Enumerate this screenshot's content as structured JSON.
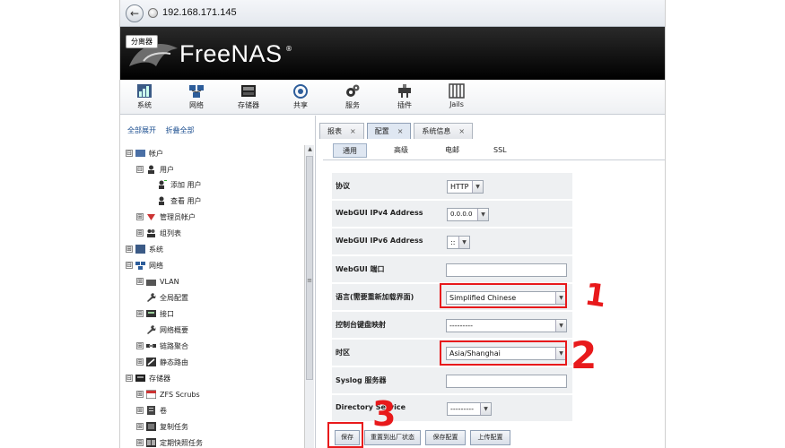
{
  "browser": {
    "url": "192.168.171.145"
  },
  "header": {
    "badge": "分离器",
    "brand": "FreeNAS",
    "brand_mark": "®"
  },
  "toolbar": [
    {
      "label": "系统"
    },
    {
      "label": "网络"
    },
    {
      "label": "存储器"
    },
    {
      "label": "共享"
    },
    {
      "label": "服务"
    },
    {
      "label": "插件"
    },
    {
      "label": "Jails"
    }
  ],
  "sidebar": {
    "expand_all": "全部展开",
    "collapse_all": "折叠全部",
    "tree": [
      {
        "label": "帐户",
        "toggle": "⊟"
      },
      {
        "label": "用户",
        "toggle": "⊟"
      },
      {
        "label": "添加 用户",
        "toggle": ""
      },
      {
        "label": "查看 用户",
        "toggle": ""
      },
      {
        "label": "管理员帐户",
        "toggle": "⊞"
      },
      {
        "label": "组列表",
        "toggle": "⊞"
      },
      {
        "label": "系统",
        "toggle": "⊞"
      },
      {
        "label": "网络",
        "toggle": "⊟"
      },
      {
        "label": "VLAN",
        "toggle": "⊞"
      },
      {
        "label": "全局配置",
        "toggle": ""
      },
      {
        "label": "接口",
        "toggle": "⊞"
      },
      {
        "label": "网络概要",
        "toggle": ""
      },
      {
        "label": "链路聚合",
        "toggle": "⊞"
      },
      {
        "label": "静态路由",
        "toggle": "⊞"
      },
      {
        "label": "存储器",
        "toggle": "⊟"
      },
      {
        "label": "ZFS Scrubs",
        "toggle": "⊞"
      },
      {
        "label": "卷",
        "toggle": "⊞"
      },
      {
        "label": "复制任务",
        "toggle": "⊞"
      },
      {
        "label": "定期快照任务",
        "toggle": "⊞"
      }
    ]
  },
  "tabs": [
    {
      "label": "报表",
      "close": "×"
    },
    {
      "label": "配置",
      "close": "×"
    },
    {
      "label": "系统信息",
      "close": "×"
    }
  ],
  "subtabs": [
    "通用",
    "高级",
    "电邮",
    "SSL"
  ],
  "form": {
    "protocol": {
      "label": "协议",
      "value": "HTTP"
    },
    "ipv4": {
      "label": "WebGUI IPv4 Address",
      "value": "0.0.0.0"
    },
    "ipv6": {
      "label": "WebGUI IPv6 Address",
      "value": "::"
    },
    "port": {
      "label": "WebGUI 端口",
      "value": ""
    },
    "language": {
      "label": "语言(需要重新加载界面)",
      "value": "Simplified Chinese"
    },
    "console_keymap": {
      "label": "控制台键盘映射",
      "value": "---------"
    },
    "timezone": {
      "label": "时区",
      "value": "Asia/Shanghai"
    },
    "syslog": {
      "label": "Syslog 服务器",
      "value": ""
    },
    "directory_service": {
      "label": "Directory Service",
      "value": "---------"
    }
  },
  "buttons": {
    "save": "保存",
    "factory_reset": "重置到出厂状态",
    "save_config": "保存配置",
    "upload_config": "上传配置"
  },
  "annotations": {
    "one": "1",
    "two": "2",
    "three": "3"
  },
  "colors": {
    "header_bg": "#111111",
    "annotation": "#e8191b",
    "tab_active": "#dfe7f2"
  }
}
